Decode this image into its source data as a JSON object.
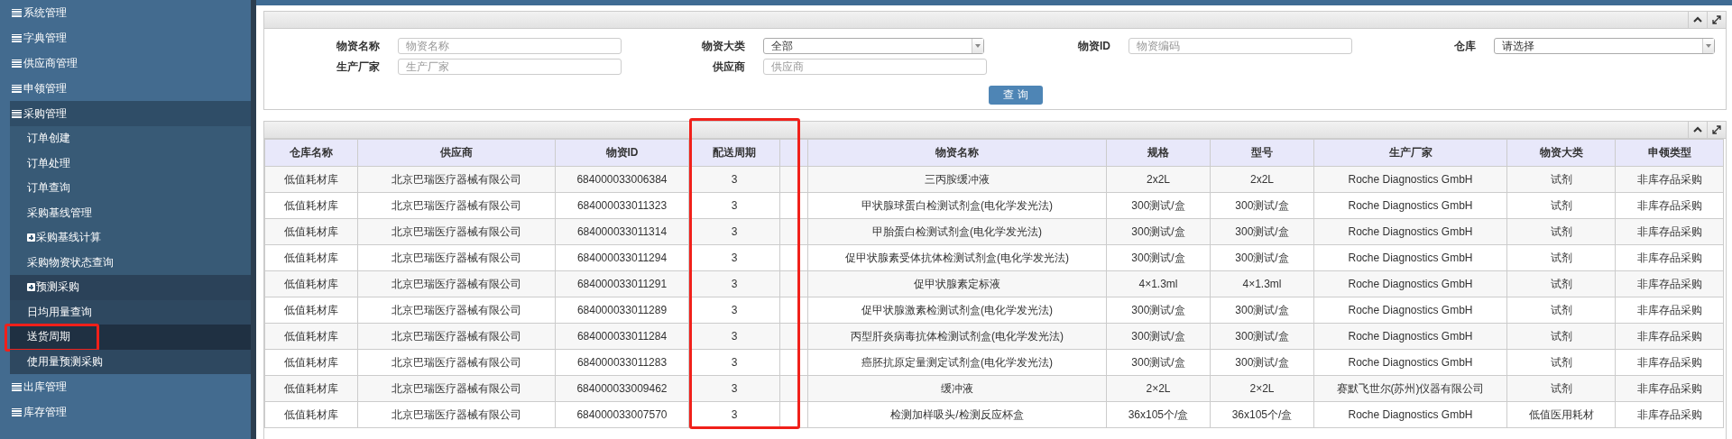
{
  "sidebar": {
    "items": [
      {
        "label": "系统管理",
        "expanded": false
      },
      {
        "label": "字典管理",
        "expanded": false
      },
      {
        "label": "供应商管理",
        "expanded": false
      },
      {
        "label": "申领管理",
        "expanded": false
      },
      {
        "label": "采购管理",
        "expanded": true,
        "children": [
          {
            "label": "订单创建",
            "kind": "link",
            "selected": false,
            "highlighted": false
          },
          {
            "label": "订单处理",
            "kind": "link",
            "selected": false,
            "highlighted": false
          },
          {
            "label": "订单查询",
            "kind": "link",
            "selected": false,
            "highlighted": false
          },
          {
            "label": "采购基线管理",
            "kind": "link",
            "selected": false,
            "highlighted": false
          },
          {
            "label": "采购基线计算",
            "kind": "toggle",
            "expanded": false,
            "selected": false,
            "highlighted": false
          },
          {
            "label": "采购物资状态查询",
            "kind": "link",
            "selected": false,
            "highlighted": false
          },
          {
            "label": "预测采购",
            "kind": "toggle",
            "expanded": true,
            "selected": false,
            "highlighted": false,
            "children": [
              {
                "label": "日均用量查询",
                "selected": false,
                "highlighted": false
              },
              {
                "label": "送货周期",
                "selected": true,
                "highlighted": true
              },
              {
                "label": "使用量预测采购",
                "selected": false,
                "highlighted": false
              }
            ]
          }
        ]
      },
      {
        "label": "出库管理",
        "expanded": false
      },
      {
        "label": "库存管理",
        "expanded": false
      }
    ]
  },
  "search_form": {
    "fields": [
      {
        "label": "物资名称",
        "kind": "input",
        "placeholder": "物资名称"
      },
      {
        "label": "物资大类",
        "kind": "select",
        "value": "全部"
      },
      {
        "label": "物资ID",
        "kind": "input",
        "placeholder": "物资编码"
      },
      {
        "label": "仓库",
        "kind": "select",
        "value": "请选择"
      },
      {
        "label": "生产厂家",
        "kind": "input",
        "placeholder": "生产厂家"
      },
      {
        "label": "供应商",
        "kind": "input",
        "placeholder": "供应商"
      }
    ],
    "button": "查 询"
  },
  "table": {
    "columns": [
      {
        "label": "仓库名称",
        "highlighted": false
      },
      {
        "label": "供应商",
        "highlighted": false
      },
      {
        "label": "物资ID",
        "highlighted": false
      },
      {
        "label": "配送周期",
        "highlighted": true
      },
      {
        "highlighted": false
      },
      {
        "label": "物资名称",
        "highlighted": false
      },
      {
        "label": "规格",
        "highlighted": false
      },
      {
        "label": "型号",
        "highlighted": false
      },
      {
        "label": "生产厂家",
        "highlighted": false
      },
      {
        "label": "物资大类",
        "highlighted": false
      },
      {
        "label": "申领类型",
        "highlighted": false
      }
    ],
    "rows": [
      [
        "低值耗材库",
        "北京巴瑞医疗器械有限公司",
        "684000033006384",
        "3",
        "",
        "三丙胺缓冲液",
        "2x2L",
        "2x2L",
        "Roche Diagnostics GmbH",
        "试剂",
        "非库存品采购"
      ],
      [
        "低值耗材库",
        "北京巴瑞医疗器械有限公司",
        "684000033011323",
        "3",
        "",
        "甲状腺球蛋白检测试剂盒(电化学发光法)",
        "300测试/盒",
        "300测试/盒",
        "Roche Diagnostics GmbH",
        "试剂",
        "非库存品采购"
      ],
      [
        "低值耗材库",
        "北京巴瑞医疗器械有限公司",
        "684000033011314",
        "3",
        "",
        "甲胎蛋白检测试剂盒(电化学发光法)",
        "300测试/盒",
        "300测试/盒",
        "Roche Diagnostics GmbH",
        "试剂",
        "非库存品采购"
      ],
      [
        "低值耗材库",
        "北京巴瑞医疗器械有限公司",
        "684000033011294",
        "3",
        "",
        "促甲状腺素受体抗体检测试剂盒(电化学发光法)",
        "300测试/盒",
        "300测试/盒",
        "Roche Diagnostics GmbH",
        "试剂",
        "非库存品采购"
      ],
      [
        "低值耗材库",
        "北京巴瑞医疗器械有限公司",
        "684000033011291",
        "3",
        "",
        "促甲状腺素定标液",
        "4×1.3ml",
        "4×1.3ml",
        "Roche Diagnostics GmbH",
        "试剂",
        "非库存品采购"
      ],
      [
        "低值耗材库",
        "北京巴瑞医疗器械有限公司",
        "684000033011289",
        "3",
        "",
        "促甲状腺激素检测试剂盒(电化学发光法)",
        "300测试/盒",
        "300测试/盒",
        "Roche Diagnostics GmbH",
        "试剂",
        "非库存品采购"
      ],
      [
        "低值耗材库",
        "北京巴瑞医疗器械有限公司",
        "684000033011284",
        "3",
        "",
        "丙型肝炎病毒抗体检测试剂盒(电化学发光法)",
        "300测试/盒",
        "300测试/盒",
        "Roche Diagnostics GmbH",
        "试剂",
        "非库存品采购"
      ],
      [
        "低值耗材库",
        "北京巴瑞医疗器械有限公司",
        "684000033011283",
        "3",
        "",
        "癌胚抗原定量测定试剂盒(电化学发光法)",
        "300测试/盒",
        "300测试/盒",
        "Roche Diagnostics GmbH",
        "试剂",
        "非库存品采购"
      ],
      [
        "低值耗材库",
        "北京巴瑞医疗器械有限公司",
        "684000033009462",
        "3",
        "",
        "缓冲液",
        "2×2L",
        "2×2L",
        "赛默飞世尔(苏州)仪器有限公司",
        "试剂",
        "非库存品采购"
      ],
      [
        "低值耗材库",
        "北京巴瑞医疗器械有限公司",
        "684000033007570",
        "3",
        "",
        "检测加样吸头/检测反应杯盒",
        "36x105个/盒",
        "36x105个/盒",
        "Roche Diagnostics GmbH",
        "低值医用耗材",
        "非库存品采购"
      ]
    ]
  }
}
